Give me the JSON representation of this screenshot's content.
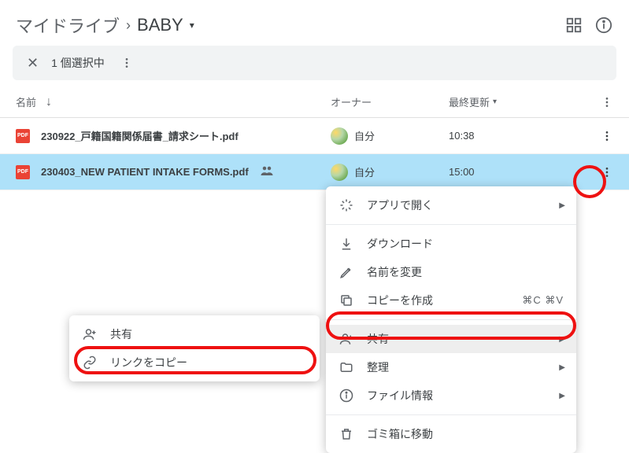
{
  "breadcrumb": {
    "root": "マイドライブ",
    "current": "BABY"
  },
  "selection_bar": {
    "text": "1 個選択中"
  },
  "columns": {
    "name": "名前",
    "owner": "オーナー",
    "updated": "最終更新"
  },
  "rows": [
    {
      "name": "230922_戸籍国籍関係届書_請求シート.pdf",
      "owner": "自分",
      "updated": "10:38",
      "selected": false,
      "shared": false
    },
    {
      "name": "230403_NEW PATIENT INTAKE FORMS.pdf",
      "owner": "自分",
      "updated": "15:00",
      "selected": true,
      "shared": true
    }
  ],
  "menu": {
    "open_with": "アプリで開く",
    "download": "ダウンロード",
    "rename": "名前を変更",
    "make_copy": "コピーを作成",
    "make_copy_shortcut": "⌘C ⌘V",
    "share": "共有",
    "organize": "整理",
    "file_info": "ファイル情報",
    "trash": "ゴミ箱に移動"
  },
  "submenu": {
    "share": "共有",
    "copy_link": "リンクをコピー"
  }
}
